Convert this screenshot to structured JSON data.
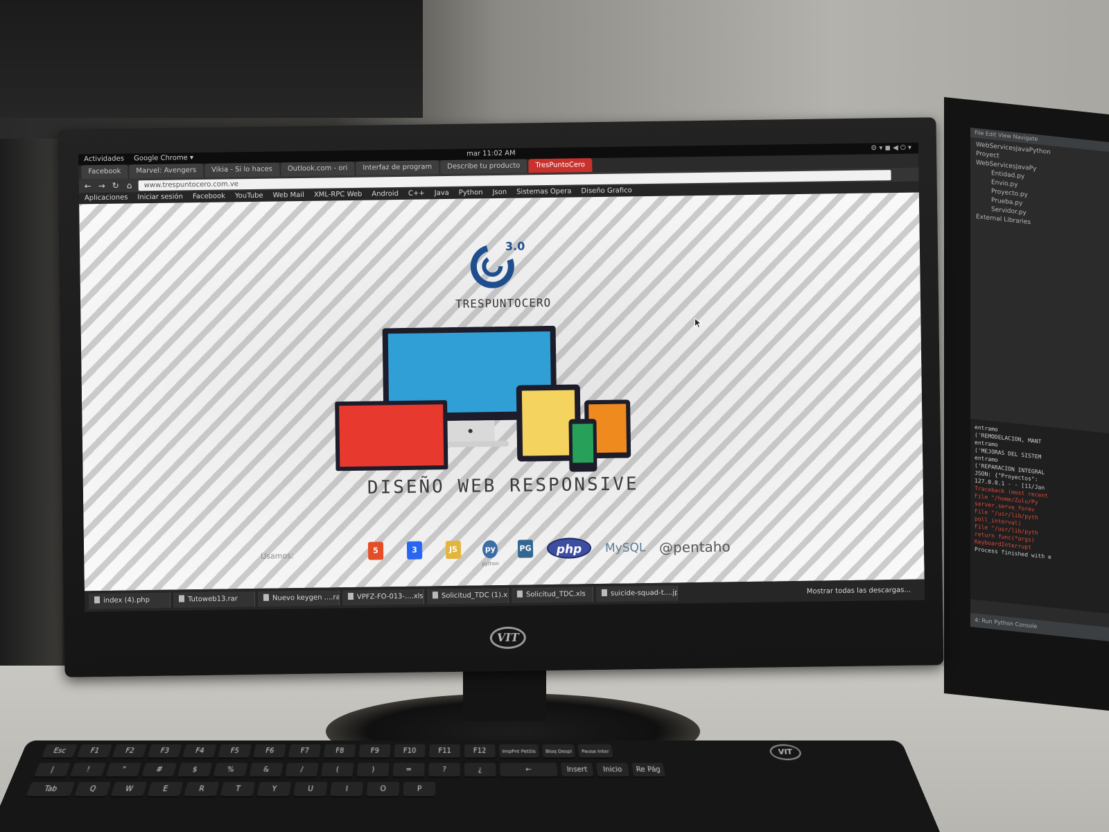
{
  "monitor": {
    "brand": "VIT"
  },
  "gnome": {
    "activities": "Actividades",
    "app": "Google Chrome ▾",
    "clock": "mar 11:02 AM",
    "tray": "⚙ ▾ ◼ ◀ ⏻ ▾"
  },
  "browser": {
    "tabs": [
      "Facebook",
      "Marvel: Avengers",
      "Vikia - Si lo haces",
      "Outlook.com - ori",
      "Interfaz de program",
      "Describe tu producto",
      "TresPuntoCero"
    ],
    "url": "www.trespuntocero.com.ve",
    "bookmarks": [
      "Aplicaciones",
      "Iniciar sesión",
      "Facebook",
      "YouTube",
      "Web Mail",
      "XML-RPC Web",
      "Android",
      "C++",
      "Java",
      "Python",
      "Json",
      "Sistemas Opera",
      "Diseño Grafico"
    ]
  },
  "site": {
    "logo_version": "3.0",
    "logo_wordmark": "TRESPUNTOCERO",
    "headline": "DISEÑO WEB RESPONSIVE",
    "usamos": "Usamos:",
    "tech": {
      "html5": "5",
      "css3": "3",
      "js": "JS",
      "python": "py",
      "python_label": "python",
      "pg": "PG",
      "php": "php",
      "mysql": "MySQL",
      "pentaho": "@pentaho"
    },
    "device_colors": {
      "desktop": "#2f9fd6",
      "laptop": "#e8392f",
      "tablet": "#f4d35e",
      "phone": "#27a05a",
      "tablet_small": "#ef8a1f"
    }
  },
  "downloads": {
    "files": [
      "index (4).php",
      "Tutoweb13.rar",
      "Nuevo keygen ....rar",
      "VPFZ-FO-013-....xls",
      "Solicitud_TDC (1).xls",
      "Solicitud_TDC.xls",
      "suicide-squad-t....jpg"
    ],
    "show_all": "Mostrar todas las descargas..."
  },
  "ide": {
    "menu": "File  Edit  View  Navigate",
    "project_root": "WebServicesJavaPython",
    "nodes": [
      "Proyect",
      "WebServicesJavaPy"
    ],
    "files": [
      "Entidad.py",
      "Envio.py",
      "Proyecto.py",
      "Prueba.py",
      "Servidor.py"
    ],
    "external": "External Libraries",
    "console": [
      "entramo",
      "('REMODELACION, MANT",
      "entramo",
      "('MEJORAS DEL SISTEM",
      "entramo",
      "('REPARACION INTEGRAL",
      "JSON: {\"Proyectos\":",
      "127.0.0.1 - - [11/Jan"
    ],
    "errors": [
      "Traceback (most recent",
      "File \"/home/Zulu/Py",
      "server.serve_forev",
      "File \"/usr/lib/pyth",
      "poll_interval)",
      "File \"/usr/lib/pyth",
      "return func(*args)",
      "KeyboardInterrupt"
    ],
    "finished": "Process finished with e",
    "status": "4: Run   Python Console"
  },
  "keyboard": {
    "brand": "VIT",
    "row1": [
      "Esc",
      "F1",
      "F2",
      "F3",
      "F4",
      "F5",
      "F6",
      "F7",
      "F8",
      "F9",
      "F10",
      "F11",
      "F12",
      "ImpPnt PetSis",
      "Bloq Despl",
      "Pausa Inter"
    ],
    "row2": [
      "|",
      "!",
      "\"",
      "#",
      "$",
      "%",
      "&",
      "/",
      "(",
      ")",
      "=",
      "?",
      "¿",
      "←",
      "Insert",
      "Inicio",
      "Re Pág"
    ],
    "row3": [
      "Tab",
      "Q",
      "W",
      "E",
      "R",
      "T",
      "Y",
      "U",
      "I",
      "O",
      "P"
    ]
  }
}
